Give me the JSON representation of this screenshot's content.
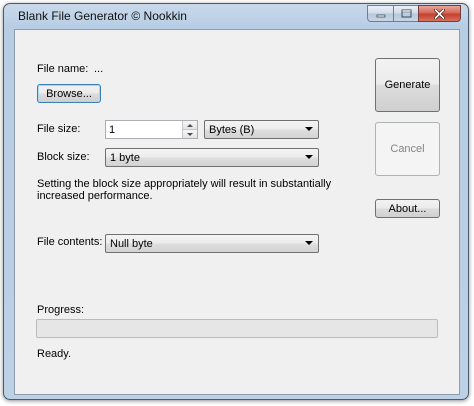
{
  "window": {
    "title": "Blank File Generator © Nookkin"
  },
  "file_name": {
    "label": "File name:",
    "value": "..."
  },
  "browse_label": "Browse...",
  "file_size": {
    "label": "File size:",
    "value": "1",
    "unit": "Bytes (B)"
  },
  "block_size": {
    "label": "Block size:",
    "value": "1 byte"
  },
  "note": "Setting the block size appropriately will result in substantially increased performance.",
  "file_contents": {
    "label": "File contents:",
    "value": "Null byte"
  },
  "buttons": {
    "generate": "Generate",
    "cancel": "Cancel",
    "about": "About..."
  },
  "progress": {
    "label": "Progress:",
    "fraction": 0
  },
  "status": "Ready.",
  "icons": {
    "minimize": "minimize-icon",
    "maximize": "maximize-icon",
    "close": "close-icon"
  },
  "colors": {
    "progress_fill": "#06b025",
    "close_button": "#c2402f"
  }
}
